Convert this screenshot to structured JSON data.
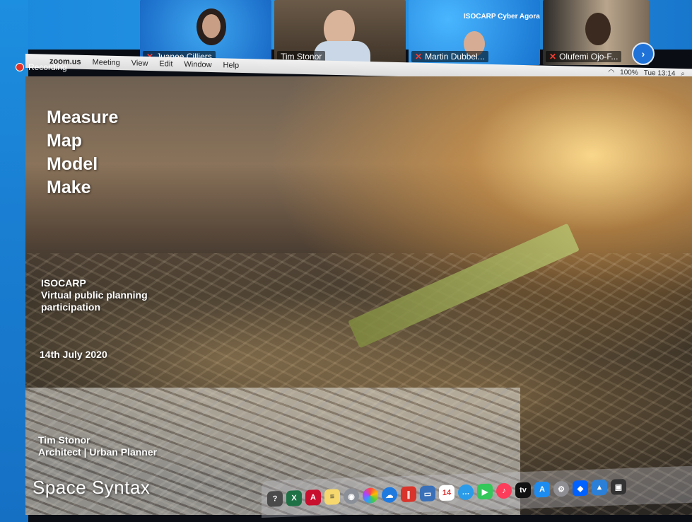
{
  "participants": [
    {
      "name": "Juanee Cilliers",
      "muted": true
    },
    {
      "name": "Tim Stonor",
      "muted": false
    },
    {
      "name": "Martin Dubbel...",
      "muted": true,
      "background_text": "ISOCARP Cyber Agora"
    },
    {
      "name": "Olufemi Ojo-F...",
      "muted": true
    }
  ],
  "menubar": {
    "app": "zoom.us",
    "items": [
      "Meeting",
      "View",
      "Edit",
      "Window",
      "Help"
    ],
    "battery": "100%",
    "clock": "Tue 13:14"
  },
  "recording_label": "Recording",
  "slide": {
    "title_words": [
      "Measure",
      "Map",
      "Model",
      "Make"
    ],
    "subtitle_lines": [
      "ISOCARP",
      "Virtual public planning",
      "participation"
    ],
    "date": "14th July 2020",
    "author_name": "Tim Stonor",
    "author_role": "Architect | Urban Planner",
    "logo_text": "Space Syntax"
  },
  "dock": {
    "calendar_day": "14",
    "icons": [
      "help-icon",
      "excel-icon",
      "acrobat-icon",
      "notes-icon",
      "launcher-icon",
      "photos-icon",
      "onedrive-icon",
      "parallels-icon",
      "preview-icon",
      "calendar-icon",
      "messages-icon",
      "facetime-icon",
      "music-icon",
      "tv-icon",
      "appstore-icon",
      "settings-icon",
      "dropbox-icon",
      "keynote-icon",
      "display-icon"
    ]
  },
  "colors": {
    "zoom_blue": "#1a88dc",
    "muted_red": "#ff3b30",
    "record_red": "#e0342b"
  }
}
